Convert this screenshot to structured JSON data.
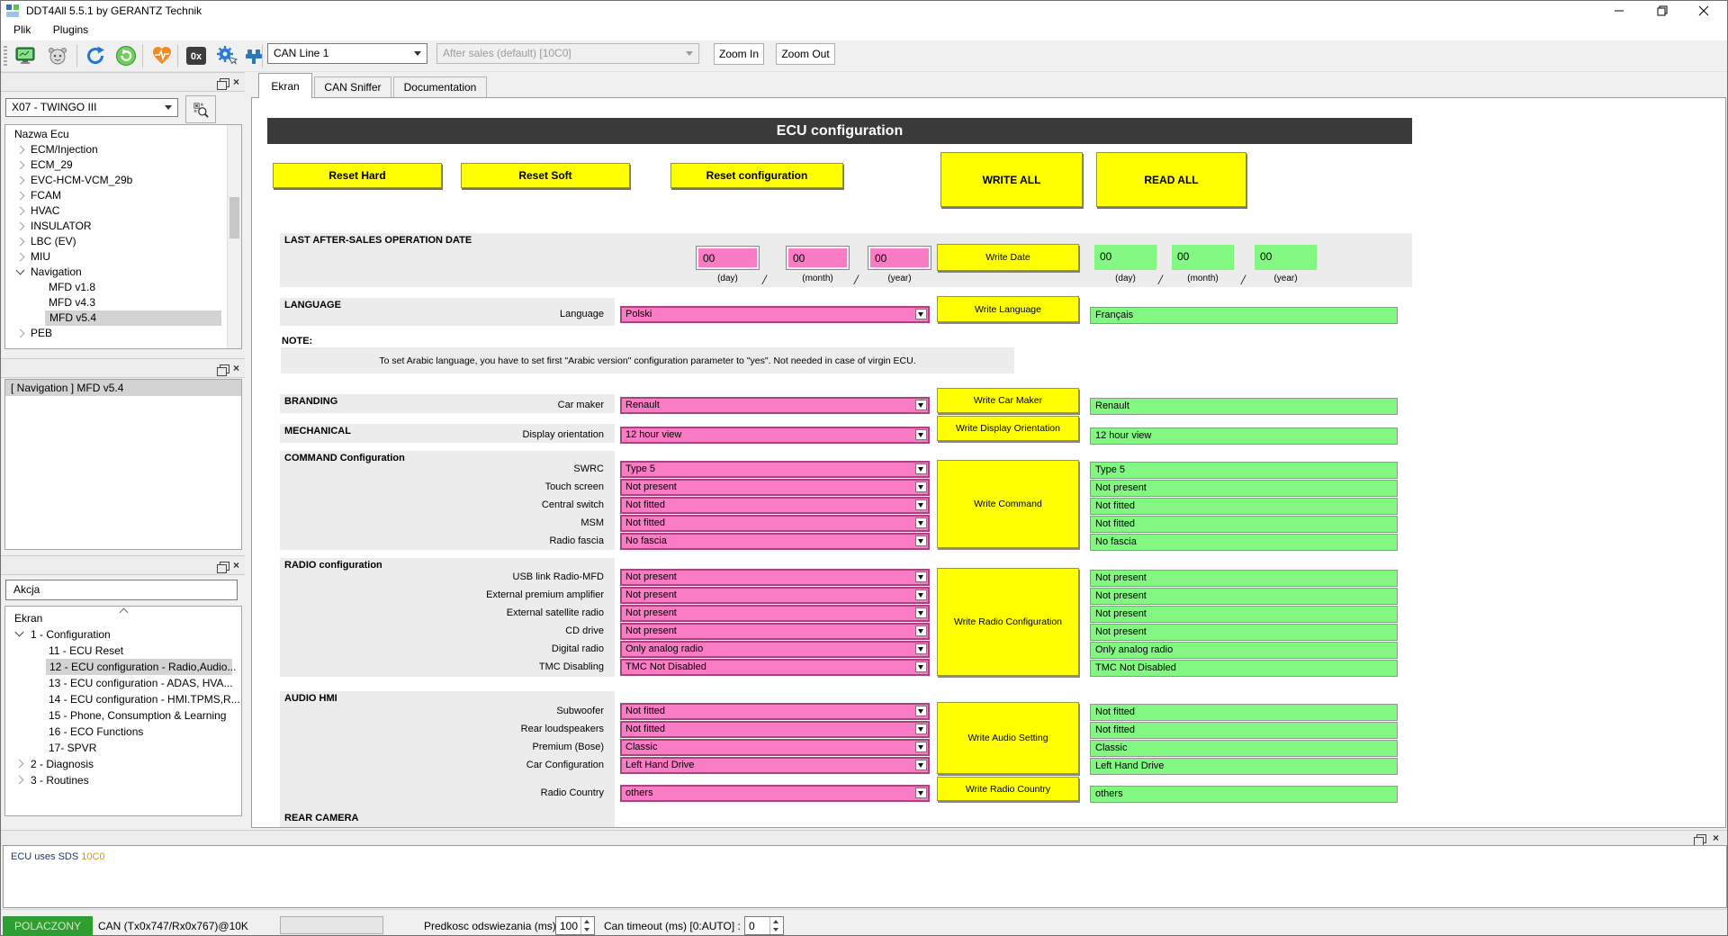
{
  "window": {
    "title": "DDT4All 5.5.1 by GERANTZ Technik"
  },
  "menu": {
    "items": [
      "Plik",
      "Plugins"
    ]
  },
  "toolbar": {
    "icons": [
      "screen-icon",
      "robot-icon",
      "refresh-blue-icon",
      "refresh-green-icon",
      "heartbeat-icon",
      "hex-icon",
      "expert-mode-icon",
      "connector-icon"
    ],
    "can_line_selected": "CAN Line 1",
    "ecu_file_selected": "After sales (default) [10C0]",
    "zoom_in_label": "Zoom In",
    "zoom_out_label": "Zoom Out"
  },
  "sidebar": {
    "vehicle_selected": "X07 - TWINGO III",
    "ecu_tree_header": "Nazwa Ecu",
    "ecu_tree": [
      {
        "label": "ECM/Injection",
        "state": "closed",
        "level": 0
      },
      {
        "label": "ECM_29",
        "state": "closed",
        "level": 0
      },
      {
        "label": "EVC-HCM-VCM_29b",
        "state": "closed",
        "level": 0
      },
      {
        "label": "FCAM",
        "state": "closed",
        "level": 0
      },
      {
        "label": "HVAC",
        "state": "closed",
        "level": 0
      },
      {
        "label": "INSULATOR",
        "state": "closed",
        "level": 0
      },
      {
        "label": "LBC (EV)",
        "state": "closed",
        "level": 0
      },
      {
        "label": "MIU",
        "state": "closed",
        "level": 0
      },
      {
        "label": "Navigation",
        "state": "open",
        "level": 0
      },
      {
        "label": "MFD v1.8",
        "state": "leaf",
        "level": 1
      },
      {
        "label": "MFD v4.3",
        "state": "leaf",
        "level": 1
      },
      {
        "label": "MFD v5.4",
        "state": "leaf",
        "level": 1,
        "selected": true
      },
      {
        "label": "PEB",
        "state": "closed",
        "level": 0
      }
    ],
    "selected_ecu_panel": "[ Navigation ] MFD v5.4",
    "action_filter_value": "Akcja",
    "action_tree": [
      {
        "label": "Ekran",
        "state": "leaf",
        "level": 0
      },
      {
        "label": "1 - Configuration",
        "state": "open",
        "level": 0
      },
      {
        "label": "11 - ECU Reset",
        "state": "leaf",
        "level": 1
      },
      {
        "label": "12 - ECU configuration - Radio,Audio...",
        "state": "leaf",
        "level": 1,
        "selected": true
      },
      {
        "label": "13 - ECU configuration - ADAS, HVA...",
        "state": "leaf",
        "level": 1
      },
      {
        "label": "14 - ECU configuration - HMI.TPMS,R...",
        "state": "leaf",
        "level": 1
      },
      {
        "label": "15 - Phone, Consumption & Learning",
        "state": "leaf",
        "level": 1
      },
      {
        "label": "16 - ECO Functions",
        "state": "leaf",
        "level": 1
      },
      {
        "label": "17- SPVR",
        "state": "leaf",
        "level": 1
      },
      {
        "label": "2 - Diagnosis",
        "state": "closed",
        "level": 0
      },
      {
        "label": "3 - Routines",
        "state": "closed",
        "level": 0
      }
    ]
  },
  "tabs": [
    {
      "label": "Ekran",
      "active": true
    },
    {
      "label": "CAN Sniffer",
      "active": false
    },
    {
      "label": "Documentation",
      "active": false
    }
  ],
  "screen": {
    "title": "ECU configuration",
    "reset_hard": "Reset Hard",
    "reset_soft": "Reset Soft",
    "reset_configuration": "Reset configuration",
    "write_all": "WRITE ALL",
    "read_all": "READ ALL",
    "date": {
      "title": "LAST AFTER-SALES OPERATION DATE",
      "write_label": "Write Date",
      "units": [
        "(day)",
        "(month)",
        "(year)"
      ],
      "write_values": [
        "00",
        "00",
        "00"
      ],
      "read_values": [
        "00",
        "00",
        "00"
      ]
    },
    "note_label": "NOTE:",
    "note_text": "To set Arabic language, you have to set first \"Arabic version\" configuration parameter to \"yes\". Not needed in case of virgin ECU.",
    "sections": [
      {
        "title": "LANGUAGE",
        "groups": [
          {
            "write": "Write Language",
            "rows": [
              {
                "label": "Language",
                "value": "Polski",
                "read": "Français"
              }
            ]
          }
        ]
      },
      {
        "title": "BRANDING",
        "groups": [
          {
            "write": "Write Car Maker",
            "rows": [
              {
                "label": "Car maker",
                "value": "Renault",
                "read": "Renault"
              }
            ]
          }
        ]
      },
      {
        "title": "MECHANICAL",
        "groups": [
          {
            "write": "Write Display Orientation",
            "rows": [
              {
                "label": "Display orientation",
                "value": "12 hour view",
                "read": "12 hour view"
              }
            ]
          }
        ]
      },
      {
        "title": "COMMAND Configuration",
        "groups": [
          {
            "write": "Write Command",
            "rows": [
              {
                "label": "SWRC",
                "value": "Type 5",
                "read": "Type 5"
              },
              {
                "label": "Touch screen",
                "value": "Not present",
                "read": "Not present"
              },
              {
                "label": "Central switch",
                "value": "Not fitted",
                "read": "Not fitted"
              },
              {
                "label": "MSM",
                "value": "Not fitted",
                "read": "Not fitted"
              },
              {
                "label": "Radio fascia",
                "value": "No fascia",
                "read": "No fascia"
              }
            ]
          }
        ]
      },
      {
        "title": "RADIO configuration",
        "groups": [
          {
            "write": "Write Radio Configuration",
            "rows": [
              {
                "label": "USB link Radio-MFD",
                "value": "Not present",
                "read": "Not present"
              },
              {
                "label": "External premium amplifier",
                "value": "Not present",
                "read": "Not present"
              },
              {
                "label": "External satellite radio",
                "value": "Not present",
                "read": "Not present"
              },
              {
                "label": "CD drive",
                "value": "Not present",
                "read": "Not present"
              },
              {
                "label": "Digital radio",
                "value": "Only analog radio",
                "read": "Only analog radio"
              },
              {
                "label": "TMC Disabling",
                "value": "TMC Not Disabled",
                "read": "TMC Not Disabled"
              }
            ]
          }
        ]
      },
      {
        "title": "AUDIO HMI",
        "groups": [
          {
            "write": "Write Audio Setting",
            "rows": [
              {
                "label": "Subwoofer",
                "value": "Not fitted",
                "read": "Not fitted"
              },
              {
                "label": "Rear loudspeakers",
                "value": "Not fitted",
                "read": "Not fitted"
              },
              {
                "label": "Premium (Bose)",
                "value": "Classic",
                "read": "Classic"
              },
              {
                "label": "Car Configuration",
                "value": "Left Hand Drive",
                "read": "Left Hand Drive"
              }
            ]
          },
          {
            "write": "Write Radio Country",
            "rows": [
              {
                "label": "Radio Country",
                "value": "others",
                "read": "others"
              }
            ]
          }
        ]
      },
      {
        "title": "REAR CAMERA",
        "groups": []
      }
    ]
  },
  "log": {
    "prefix": "ECU uses SDS",
    "sds": "10C0"
  },
  "statusbar": {
    "connection": "POLACZONY",
    "can_info": "CAN (Tx0x747/Rx0x767)@10K",
    "refresh_label": "Predkosc odswiezania (ms)",
    "refresh_value": "100",
    "timeout_label": "Can timeout (ms) [0:AUTO] :",
    "timeout_value": "0"
  },
  "colors": {
    "write_pink": "#fa7cc5",
    "read_green": "#82f883",
    "button_yellow": "#ffff00",
    "header_dark": "#3a3a3a",
    "connected_green": "#2f9e32",
    "sds_orange": "#d0a000",
    "log_blue": "#1f3864"
  }
}
